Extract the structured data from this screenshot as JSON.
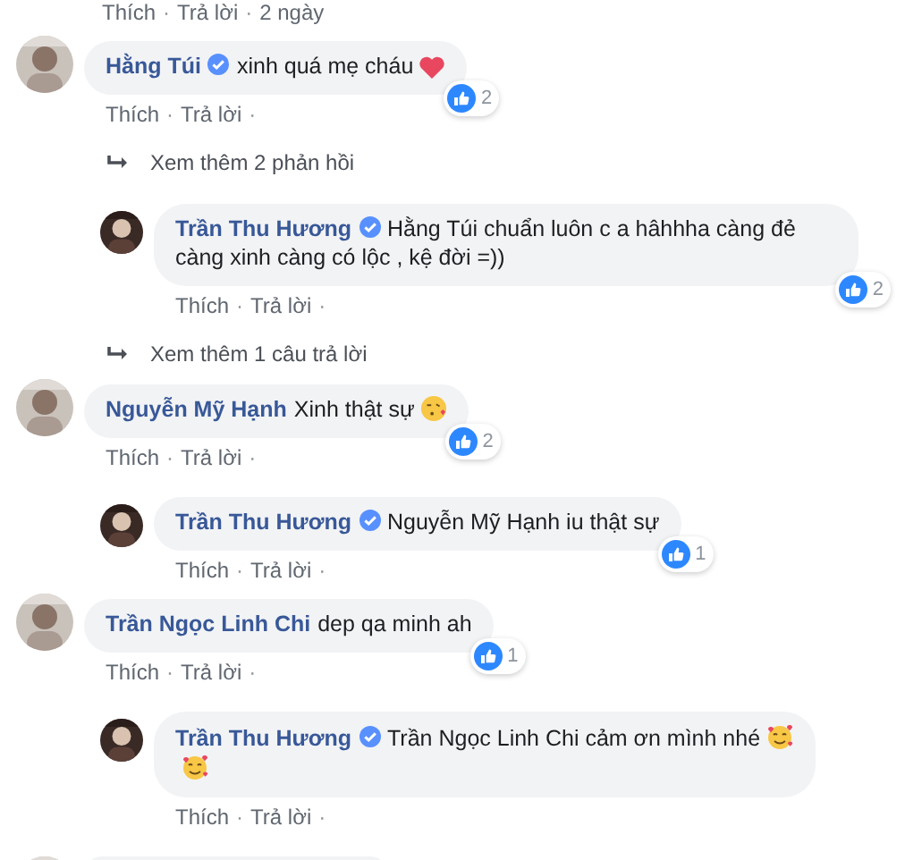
{
  "separator": "·",
  "top_actions": [
    "Thích",
    "Trả lời",
    "2 ngày"
  ],
  "entries": [
    {
      "kind": "comment",
      "name": "Hằng Túi",
      "verified": true,
      "text": "xinh quá mẹ cháu",
      "trailing_icon": {
        "kind": "heart"
      },
      "likes": "2",
      "actions": [
        "Thích",
        "Trả lời"
      ]
    },
    {
      "kind": "more",
      "text": "Xem thêm 2 phản hồi"
    },
    {
      "kind": "reply",
      "name": "Trần Thu Hương",
      "verified": true,
      "text": "Hằng Túi chuẩn luôn c a hâhhha càng đẻ càng xinh càng có lộc , kệ đời =))",
      "likes": "2",
      "actions": [
        "Thích",
        "Trả lời"
      ]
    },
    {
      "kind": "more",
      "text": "Xem thêm 1 câu trả lời"
    },
    {
      "kind": "comment",
      "name": "Nguyễn Mỹ Hạnh",
      "verified": false,
      "text": "Xinh thật sự",
      "trailing_icon": {
        "kind": "kiss"
      },
      "likes": "2",
      "actions": [
        "Thích",
        "Trả lời"
      ]
    },
    {
      "kind": "reply",
      "name": "Trần Thu Hương",
      "verified": true,
      "text": "Nguyễn Mỹ Hạnh iu thật sự",
      "likes": "1",
      "actions": [
        "Thích",
        "Trả lời"
      ]
    },
    {
      "kind": "comment",
      "name": "Trần Ngọc Linh Chi",
      "verified": false,
      "text": "dep qa minh ah",
      "likes": "1",
      "actions": [
        "Thích",
        "Trả lời"
      ]
    },
    {
      "kind": "reply",
      "name": "Trần Thu Hương",
      "verified": true,
      "text": "Trần Ngọc Linh Chi cảm ơn mình nhé",
      "trailing_icon": {
        "kind": "hearts_face"
      },
      "second_line_icon": {
        "kind": "hearts_face"
      },
      "actions": [
        "Thích",
        "Trả lời"
      ]
    },
    {
      "kind": "cut"
    }
  ]
}
